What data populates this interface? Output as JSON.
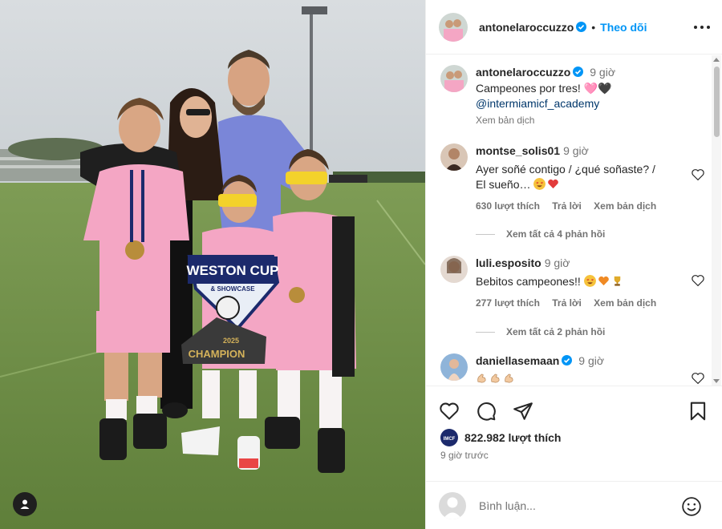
{
  "post": {
    "author": "antonelaroccuzzo",
    "verified": true,
    "follow_label": "Theo dõi",
    "caption_time": "9 giờ",
    "caption_line1": "Campeones por tres! 🩷🖤",
    "caption_mention": "@intermiamicf_academy",
    "caption_translate": "Xem bản dịch",
    "photo_banner_top": "WESTON CUP",
    "photo_banner_sub": "& SHOWCASE",
    "photo_banner_bottom": "CHAMPION",
    "photo_banner_year": "2025"
  },
  "comments": [
    {
      "user": "montse_solis01",
      "time": "9 giờ",
      "text_line1": "Ayer soñé contigo / ¿qué soñaste? /",
      "text_line2": "El sueño…",
      "likes": "630 lượt thích",
      "reply": "Trả lời",
      "translate": "Xem bản dịch",
      "view_replies": "Xem tất cả 4 phản hồi"
    },
    {
      "user": "luli.esposito",
      "time": "9 giờ",
      "text": "Bebitos campeones!!",
      "likes": "277 lượt thích",
      "reply": "Trả lời",
      "translate": "Xem bản dịch",
      "view_replies": "Xem tất cả 2 phản hồi"
    },
    {
      "user": "daniellasemaan",
      "verified": true,
      "time": "9 giờ"
    }
  ],
  "engagement": {
    "likes": "822.982 lượt thích",
    "posted_ago": "9 giờ trước"
  },
  "composer": {
    "placeholder": "Bình luận..."
  },
  "icons": {
    "like": "heart-icon",
    "comment": "comment-icon",
    "share": "share-icon",
    "save": "bookmark-icon",
    "more": "more-icon",
    "emoji": "smiley-icon",
    "tags": "user-tag-icon"
  },
  "colors": {
    "accent": "#0095f6",
    "verified": "#0095f6",
    "heart_red": "#ed4956",
    "kit_pink": "#f4a6c4"
  }
}
